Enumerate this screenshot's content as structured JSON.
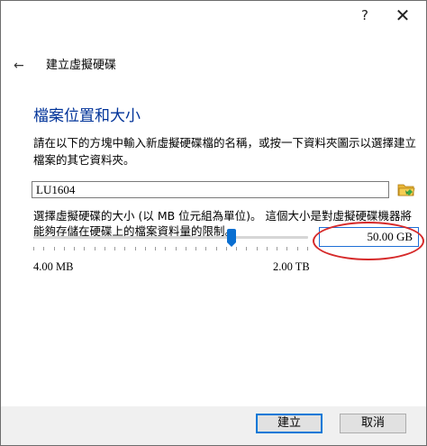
{
  "titlebar": {
    "help_glyph": "?",
    "close_glyph": "✕"
  },
  "nav": {
    "back_glyph": "←",
    "title": "建立虛擬硬碟"
  },
  "section": {
    "title": "檔案位置和大小",
    "description": "請在以下的方塊中輸入新虛擬硬碟檔的名稱，或按一下資料夾圖示以選擇建立檔案的其它資料夾。"
  },
  "file": {
    "name": "LU1604",
    "browse_icon": "folder-icon"
  },
  "size": {
    "description": "選擇虛擬硬碟的大小 (以 MB 位元組為單位)。 這個大小是對虛擬硬碟機器將能夠存儲在硬碟上的檔案資料量的限制。",
    "value": "50.00 GB",
    "min_label": "4.00 MB",
    "max_label": "2.00 TB",
    "slider_position": 0.72
  },
  "buttons": {
    "create": "建立",
    "cancel": "取消"
  },
  "colors": {
    "title": "#003399",
    "accent": "#0078d7",
    "highlight_ring": "#d62a2a"
  }
}
